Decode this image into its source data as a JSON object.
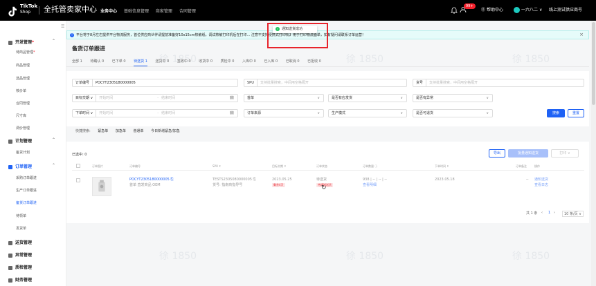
{
  "topbar": {
    "logo_text": "TikTok",
    "logo_sub": "Shop",
    "title": "全托管卖家中心",
    "nav": [
      {
        "label": "业务中心",
        "active": true
      },
      {
        "label": "基础信息管理",
        "active": false
      },
      {
        "label": "商家管理",
        "active": false
      },
      {
        "label": "合同管理",
        "active": false
      }
    ],
    "badge": "99+",
    "help": "帮助中心",
    "user": "一六八二",
    "shop": "线上测试供应商号"
  },
  "sidebar": {
    "toggle": "☰",
    "groups": [
      {
        "label": "开发管理",
        "dot": "*",
        "items": [
          {
            "label": "待商品管理",
            "dot": "*"
          },
          {
            "label": "商品管理"
          },
          {
            "label": "选品管理"
          },
          {
            "label": "核价单"
          },
          {
            "label": "合同管理"
          },
          {
            "label": "尺寸库"
          },
          {
            "label": "调价管理"
          }
        ]
      },
      {
        "label": "计划管理",
        "items": [
          {
            "label": "备货计划"
          }
        ]
      },
      {
        "label": "订单管理",
        "items": [
          {
            "label": "采购订单跟进"
          },
          {
            "label": "生产订单跟进"
          },
          {
            "label": "备货订单跟进",
            "active": true
          },
          {
            "label": "待领单"
          },
          {
            "label": "发货单"
          }
        ]
      },
      {
        "label": "送货管理",
        "items": []
      },
      {
        "label": "异常管理",
        "items": []
      },
      {
        "label": "质检管理",
        "items": []
      },
      {
        "label": "财务管理",
        "items": []
      }
    ]
  },
  "notice": {
    "text": "平台将于8月左右提供平台物流服务，首位供应商伙伴请提前准备好10x15cm热敏纸，调试热敏打印机后在打印... 注意不支持便携式打印机】用于打印物流面单，如有疑问请联系订单运营！",
    "close": "×"
  },
  "toast": {
    "text": "通知送货成功"
  },
  "page": {
    "title": "备货订单跟进"
  },
  "tabs": [
    {
      "label": "全部 1"
    },
    {
      "label": "待确认 0"
    },
    {
      "label": "已下单 0"
    },
    {
      "label": "待送货 1",
      "active": true
    },
    {
      "label": "送货中 0"
    },
    {
      "label": "签收中 0"
    },
    {
      "label": "收货中 0"
    },
    {
      "label": "质检中 0"
    },
    {
      "label": "入库中 0"
    },
    {
      "label": "已入库 0"
    },
    {
      "label": "已取消 0"
    },
    {
      "label": "已拒收 0"
    }
  ],
  "filters": {
    "order_no": {
      "label": "订单编号",
      "value": "POCYT2305180000005"
    },
    "spu": {
      "label": "SPU",
      "placeholder": "支持批量搜索，中间用空格隔开"
    },
    "goods_no": {
      "label": "货号",
      "placeholder": "支持批量搜索，中间用空格隔开"
    },
    "target_date": {
      "label": "目标交期",
      "start": "开始时间",
      "end": "结束时间"
    },
    "status": {
      "label": "首单"
    },
    "on_time": {
      "label": "是否有应发货"
    },
    "abnormal": {
      "label": "是否有异常"
    },
    "order_time": {
      "label": "下单时间",
      "start": "开始时间",
      "end": "结束时间"
    },
    "source": {
      "label": "订单来源"
    },
    "mode": {
      "label": "生产模式"
    },
    "returnable": {
      "label": "是否可退货"
    },
    "search_btn": "搜索",
    "reset_btn": "重置"
  },
  "quick_search": {
    "label": "快捷搜索:",
    "items": [
      "紧急单",
      "加急单",
      "普通单",
      "今日新增紧急/加急"
    ]
  },
  "table": {
    "selected": "已选中: 0",
    "export_btn": "导出",
    "batch_btn": "批量通知送货",
    "batch_more": "打印 ∨",
    "headers": [
      "订单图片",
      "订单编号",
      "SPU ↕",
      "目标交期 ↕",
      "订单状态",
      "订单数量 ⓘ",
      "下单时间 ↕",
      "订单备注",
      "操作"
    ],
    "row": {
      "order_no": "POCYT2305180000005",
      "order_meta": "首单   直发商品   OEM",
      "spu": "TESTS2305080000005",
      "spu_meta": "货号: 指南商指导号",
      "target_date": "2023.05.25",
      "target_tag": "剩余4天",
      "status": "待送货",
      "status_tag": "待通知送货",
      "qty": "938 | -- | -- | --",
      "qty_link": "查看明细",
      "order_time": "2023.05.18",
      "remark": "--",
      "action_1": "通知送货",
      "action_2": "查看日志"
    },
    "pager": {
      "total": "共 1 条",
      "page": "1",
      "per_page": "10 条/页 ∨"
    }
  },
  "watermark": "徐 1850"
}
